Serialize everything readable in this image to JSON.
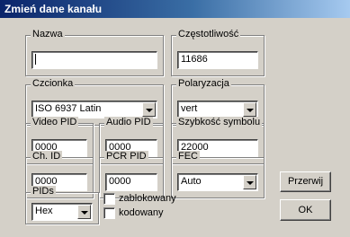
{
  "window": {
    "title": "Zmień dane kanału"
  },
  "groups": {
    "nazwa": {
      "label": "Nazwa",
      "value": ""
    },
    "czestotliwosc": {
      "label": "Częstotliwość",
      "value": "11686"
    },
    "czcionka": {
      "label": "Czcionka",
      "value": "ISO 6937 Latin"
    },
    "polaryzacja": {
      "label": "Polaryzacja",
      "value": "vert"
    },
    "video_pid": {
      "label": "Video PID",
      "value": "0000"
    },
    "audio_pid": {
      "label": "Audio PID",
      "value": "0000"
    },
    "szybkosc": {
      "label": "Szybkość symbolu",
      "value": "22000"
    },
    "ch_id": {
      "label": "Ch. ID",
      "value": "0000"
    },
    "pcr_pid": {
      "label": "PCR PID",
      "value": "0000"
    },
    "fec": {
      "label": "FEC",
      "value": "Auto"
    },
    "pids": {
      "label": "PIDs",
      "value": "Hex"
    }
  },
  "checkboxes": {
    "zablokowany": {
      "label": "zablokowany",
      "checked": false
    },
    "kodowany": {
      "label": "kodowany",
      "checked": false
    }
  },
  "buttons": {
    "cancel": "Przerwij",
    "ok": "OK"
  }
}
